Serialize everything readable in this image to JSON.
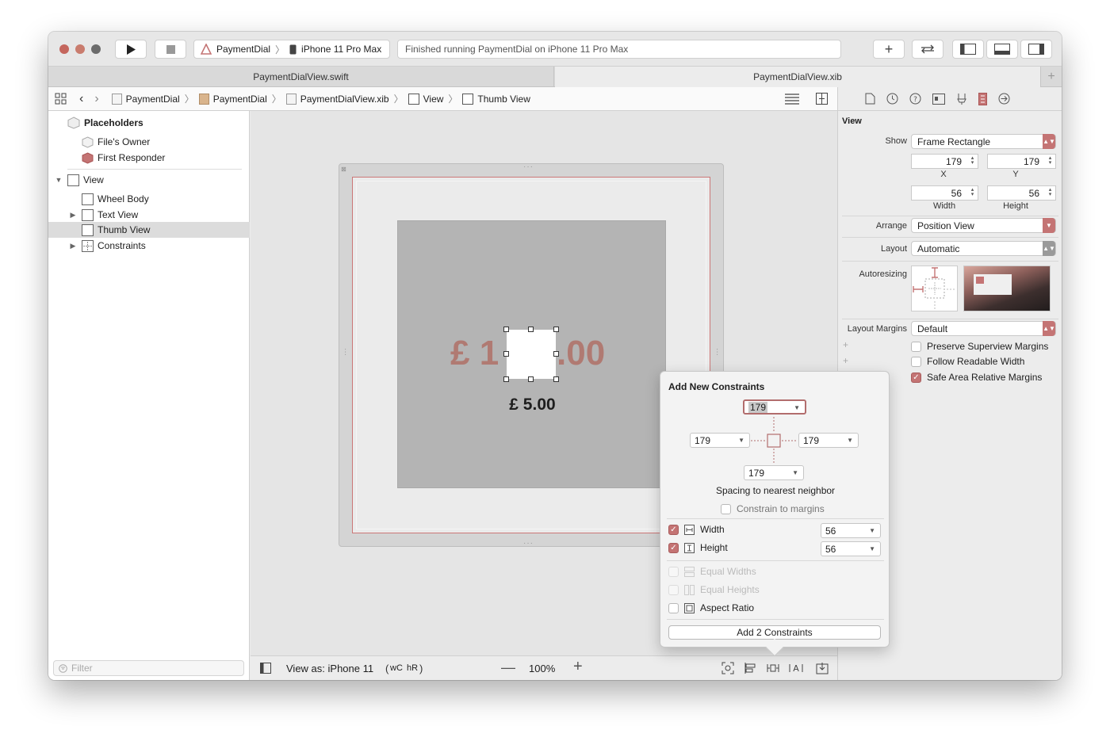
{
  "toolbar": {
    "scheme_project": "PaymentDial",
    "scheme_device": "iPhone 11 Pro Max",
    "status": "Finished running PaymentDial on iPhone 11 Pro Max",
    "accent": "#c47474"
  },
  "tabs": [
    {
      "label": "PaymentDialView.swift"
    },
    {
      "label": "PaymentDialView.xib"
    }
  ],
  "jumpbar": {
    "items": [
      "PaymentDial",
      "PaymentDial",
      "PaymentDialView.xib",
      "View",
      "Thumb View"
    ]
  },
  "outline": {
    "placeholders_header": "Placeholders",
    "files_owner": "File's Owner",
    "first_responder": "First Responder",
    "view": "View",
    "wheel_body": "Wheel Body",
    "text_view": "Text View",
    "thumb_view": "Thumb View",
    "constraints": "Constraints",
    "filter_placeholder": "Filter"
  },
  "canvas": {
    "amount_text": "£ 1",
    "amount_suffix": ".00",
    "label": "£ 5.00",
    "view_as": "View as: iPhone 11",
    "size_class_w": "wC",
    "size_class_h": "hR",
    "zoom": "100%"
  },
  "inspector": {
    "section": "View",
    "show_label": "Show",
    "show_value": "Frame Rectangle",
    "x_value": "179",
    "y_value": "179",
    "x_label": "X",
    "y_label": "Y",
    "width_value": "56",
    "height_value": "56",
    "width_label": "Width",
    "height_label": "Height",
    "arrange_label": "Arrange",
    "arrange_value": "Position View",
    "layout_label": "Layout",
    "layout_value": "Automatic",
    "autoresizing_label": "Autoresizing",
    "layout_margins_label": "Layout Margins",
    "layout_margins_value": "Default",
    "preserve_margins": "Preserve Superview Margins",
    "follow_readable": "Follow Readable Width",
    "safe_area": "Safe Area Relative Margins"
  },
  "constraints_popover": {
    "title": "Add New Constraints",
    "top": "179",
    "left": "179",
    "right": "179",
    "bottom": "179",
    "spacing_label": "Spacing to nearest neighbor",
    "constrain_margins": "Constrain to margins",
    "width_label": "Width",
    "width_value": "56",
    "height_label": "Height",
    "height_value": "56",
    "equal_widths": "Equal Widths",
    "equal_heights": "Equal Heights",
    "aspect_ratio": "Aspect Ratio",
    "add_button": "Add 2 Constraints"
  }
}
